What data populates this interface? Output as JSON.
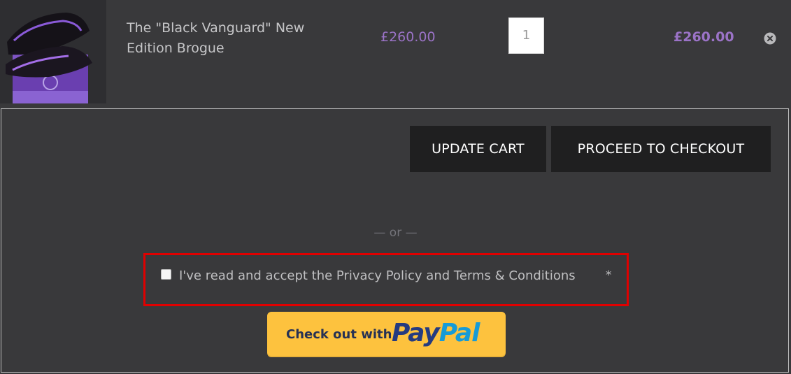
{
  "cart_item": {
    "image_alt": "black and purple brogue shoe product image",
    "name": "The \"Black Vanguard\" New Edition Brogue",
    "unit_price": "£260.00",
    "quantity": "1",
    "line_total": "£260.00",
    "remove_icon": "close-circle-icon"
  },
  "actions": {
    "update_cart": "UPDATE CART",
    "proceed_to_checkout": "PROCEED TO CHECKOUT"
  },
  "separator": "— or —",
  "consent": {
    "checked": false,
    "label": "I've read and accept the Privacy Policy and Terms & Conditions",
    "required_marker": "*"
  },
  "paypal": {
    "prefix": "Check out with",
    "brand_pay": "Pay",
    "brand_pal": "Pal"
  },
  "colors": {
    "background": "#39393b",
    "price_accent": "#9b73c7",
    "button_dark": "#1f1f20",
    "consent_highlight": "#e00000",
    "paypal_yellow": "#fdc23e"
  }
}
